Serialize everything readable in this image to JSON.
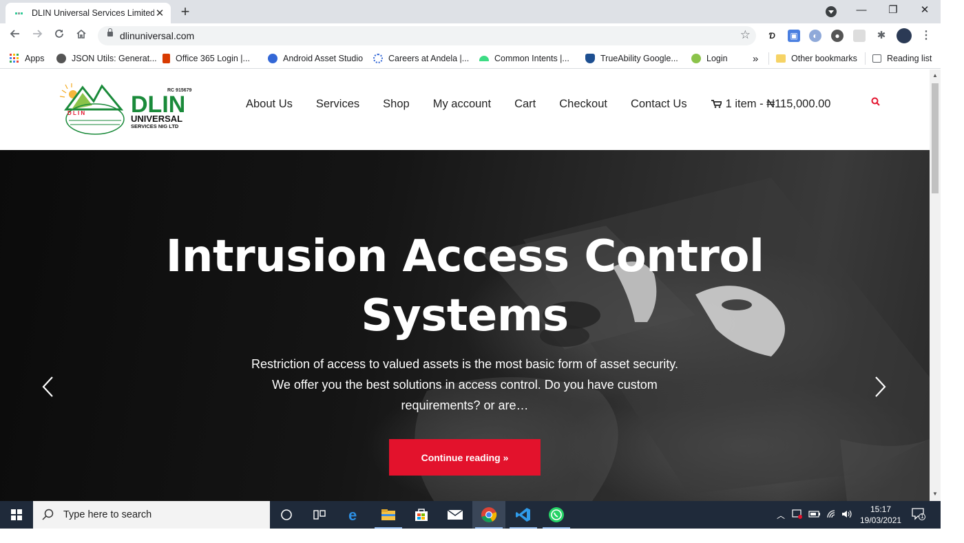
{
  "browser": {
    "tab_title": "DLIN Universal Services Limited",
    "tab_close": "✕",
    "new_tab": "+",
    "url": "dlinuniversal.com",
    "window": {
      "minimize": "—",
      "restore": "❐",
      "close": "✕"
    }
  },
  "bookmarks": [
    {
      "label": "Apps",
      "icon": "apps-grid-icon"
    },
    {
      "label": "JSON Utils: Generat...",
      "icon": "globe-icon"
    },
    {
      "label": "Office 365 Login |...",
      "icon": "office-icon"
    },
    {
      "label": "Android Asset Studio",
      "icon": "android-studio-icon"
    },
    {
      "label": "Careers at Andela |...",
      "icon": "andela-icon"
    },
    {
      "label": "Common Intents |...",
      "icon": "android-icon"
    },
    {
      "label": "TrueAbility Google...",
      "icon": "shield-icon"
    },
    {
      "label": "Login",
      "icon": "login-icon"
    }
  ],
  "bookmarks_overflow": "»",
  "other_bookmarks": "Other bookmarks",
  "reading_list": "Reading list",
  "site": {
    "logo": {
      "rc": "RC 915679",
      "line1": "DLIN",
      "line2": "UNIVERSAL",
      "line3": "SERVICES NIG LTD",
      "hill_text": "D L I N"
    },
    "nav": [
      "About Us",
      "Services",
      "Shop",
      "My account",
      "Cart",
      "Checkout",
      "Contact Us"
    ],
    "cart_summary": "1 item - ₦115,000.00",
    "hero": {
      "title": "Intrusion Access Control Systems",
      "text": "Restriction of access to valued assets is the most basic form of asset security. We offer you the best solutions in access control. Do you have custom requirements? or are…",
      "button": "Continue reading »"
    }
  },
  "taskbar": {
    "search_placeholder": "Type here to search",
    "time": "15:17",
    "date": "19/03/2021",
    "notifications": "1"
  },
  "colors": {
    "accent": "#e3122c",
    "logo_green": "#1a8a3a",
    "taskbar": "#1f2a3a"
  }
}
